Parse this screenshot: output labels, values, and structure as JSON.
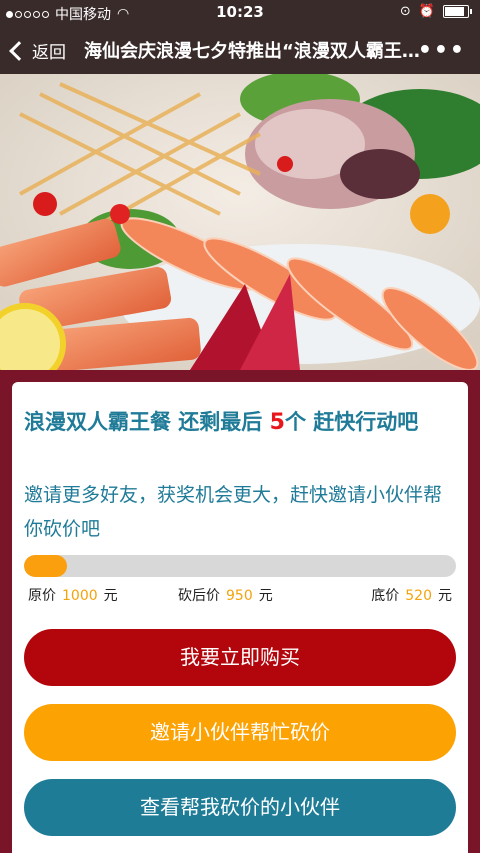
{
  "status": {
    "carrier": "中国移动",
    "time": "10:23",
    "icons": [
      "signal-dots",
      "wifi-icon",
      "lock-rotation-icon",
      "alarm-icon",
      "battery-icon"
    ]
  },
  "nav": {
    "back_label": "返回",
    "title": "海仙会庆浪漫七夕特推出“浪漫双人霸王餐”活动",
    "more_label": "•••"
  },
  "offer": {
    "headline_pre": "浪漫双人霸王餐 还剩最后 ",
    "count": "5",
    "headline_post": "个 赶快行动吧",
    "invite_text": "邀请更多好友，获奖机会更大，赶快邀请小伙伴帮你砍价吧"
  },
  "progress": {
    "fraction": 0.1
  },
  "prices": {
    "original_label": "原价",
    "original_value": "1000",
    "after_label": "砍后价",
    "after_value": "950",
    "floor_label": "底价",
    "floor_value": "520",
    "unit": "元"
  },
  "buttons": {
    "buy": "我要立即购买",
    "invite": "邀请小伙伴帮忙砍价",
    "view": "查看帮我砍价的小伙伴"
  },
  "colors": {
    "accent_red": "#b3060c",
    "accent_orange": "#fca203",
    "accent_teal": "#1f7c97",
    "text_teal": "#1f7b98",
    "background": "#7a1428"
  }
}
